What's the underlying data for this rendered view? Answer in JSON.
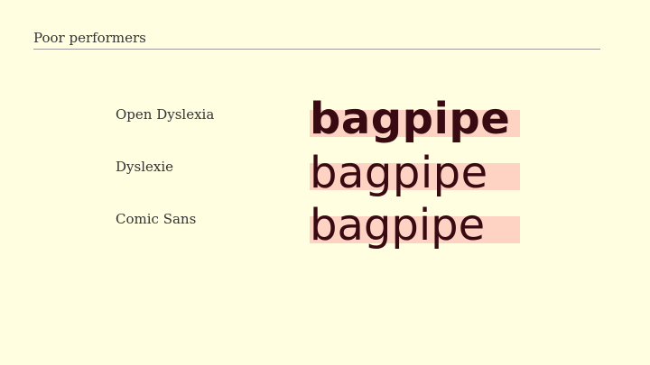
{
  "slide": {
    "heading": "Poor performers",
    "rows": [
      {
        "font_name": "Open Dyslexia",
        "sample": "bagpipe"
      },
      {
        "font_name": "Dyslexie",
        "sample": "bagpipe"
      },
      {
        "font_name": "Comic Sans",
        "sample": "bagpipe"
      }
    ],
    "colors": {
      "background": "#fffee0",
      "highlight_band": "#ffd3c4",
      "sample_text": "#3a0a12",
      "label_text": "#333333",
      "rule": "#9a9a9a"
    }
  }
}
